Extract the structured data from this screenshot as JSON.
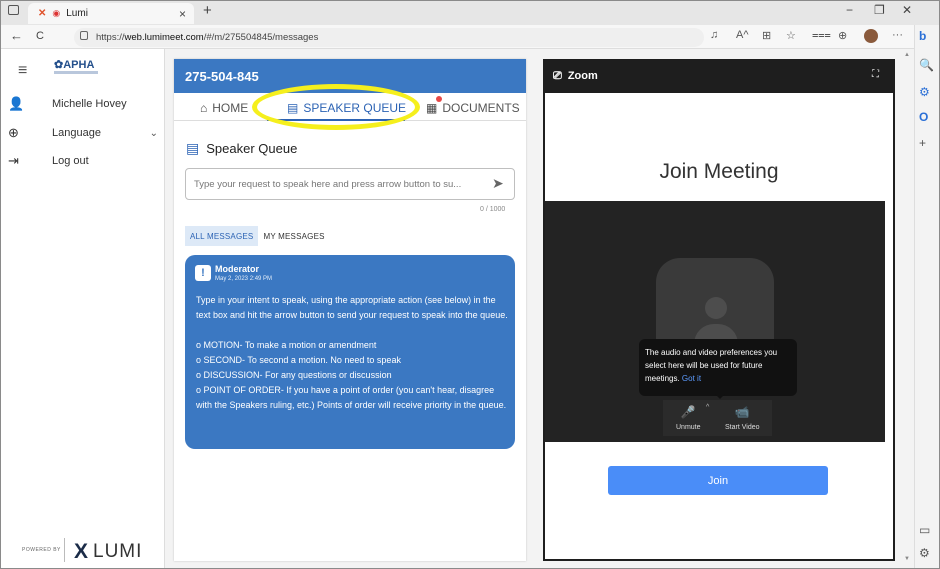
{
  "browser": {
    "tab_title": "Lumi",
    "url_prefix": "https://",
    "url_host": "web.lumimeet.com",
    "url_path": "/#/m/275504845/messages",
    "new_tab": "+",
    "close_tab": "×",
    "minimize": "−",
    "restore": "❐",
    "close": "✕",
    "back": "←",
    "refresh": "C",
    "lock": "🔒",
    "more": "···",
    "toolbar_icons": [
      "♫",
      "A^",
      "⊞",
      "☆",
      "⩶",
      "⊕"
    ],
    "sidebar_icons": [
      "b",
      "🔍",
      "⚙",
      "O",
      "+",
      "▭",
      "⚙"
    ]
  },
  "sidebar": {
    "menu_icon": "≡",
    "logo_text": "✿APHA",
    "items": [
      {
        "icon": "👤",
        "label": "Michelle Hovey"
      },
      {
        "icon": "⊕",
        "label": "Language",
        "chevron": "⌄"
      },
      {
        "icon": "⇥",
        "label": "Log out"
      }
    ],
    "powered_by": "POWERED BY",
    "brand": "LUMI",
    "brand_mark": "X"
  },
  "meeting": {
    "id": "275-504-845",
    "tabs": [
      {
        "icon": "⌂",
        "label": "HOME"
      },
      {
        "icon": "▤",
        "label": "SPEAKER QUEUE"
      },
      {
        "icon": "▦",
        "label": "DOCUMENTS"
      }
    ],
    "section_icon": "▤",
    "section_title": "Speaker Queue",
    "input_placeholder": "Type your request to speak here and press arrow button to su...",
    "send_icon": "➤",
    "char_count": "0 / 1000",
    "message_tabs": [
      "ALL MESSAGES",
      "MY MESSAGES"
    ],
    "message": {
      "icon": "!",
      "from": "Moderator",
      "date": "May 2, 2023 2:49 PM",
      "intro": "Type in your intent to speak, using the appropriate action (see below) in the text box and hit the arrow button to send your request to speak into the queue.",
      "lines": [
        "o MOTION- To make a motion or amendment",
        "o SECOND- To second a motion. No need to speak",
        "o DISCUSSION- For any questions or discussion",
        "o POINT OF ORDER- If you have a point of order (you can't hear, disagree with the Speakers ruling, etc.) Points of order will receive priority in the queue."
      ]
    }
  },
  "zoom": {
    "icon": "⎚",
    "title": "Zoom",
    "expand_icon": "⛶",
    "join_title": "Join Meeting",
    "tooltip_text": "The audio and video preferences you select here will be used for future meetings.",
    "tooltip_link": "Got it",
    "controls": [
      {
        "icon": "🎤",
        "label": "Unmute"
      },
      {
        "icon": "📹",
        "label": "Start Video"
      }
    ],
    "caret": "^",
    "join_button": "Join"
  }
}
